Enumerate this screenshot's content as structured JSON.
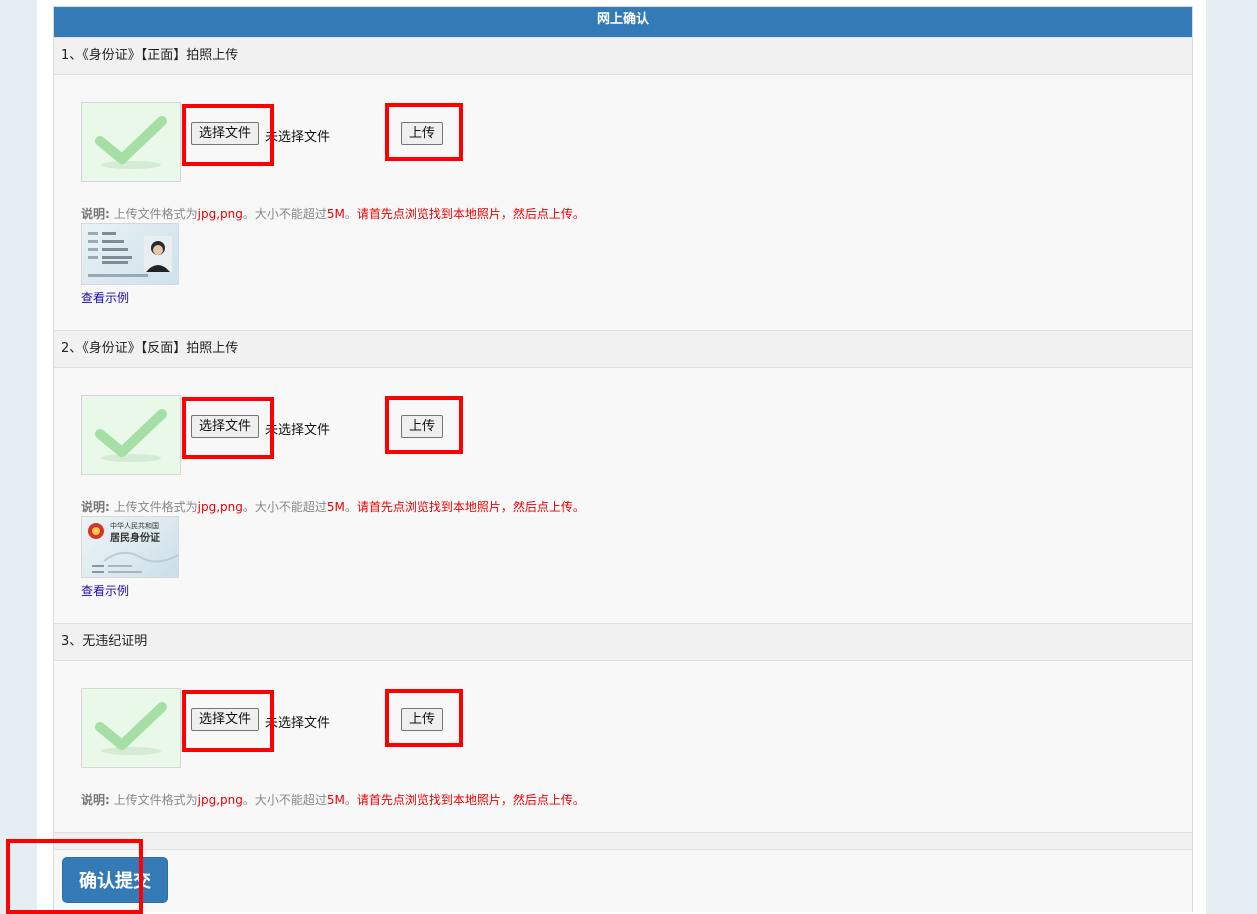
{
  "panel": {
    "title": "网上确认"
  },
  "sections": [
    {
      "title": "1、《身份证》【正面】拍照上传",
      "choose_label": "选择文件",
      "no_file_text": "未选择文件",
      "upload_label": "上传",
      "note_label": "说明:",
      "note_text_1": "上传文件格式为",
      "note_formats": "jpg,png",
      "note_text_2": "。大小不能超过",
      "note_size": "5M",
      "note_text_3": "。",
      "note_instruction": "请首先点浏览找到本地照片，然后点上传。",
      "view_example": "查看示例"
    },
    {
      "title": "2、《身份证》【反面】拍照上传",
      "choose_label": "选择文件",
      "no_file_text": "未选择文件",
      "upload_label": "上传",
      "note_label": "说明:",
      "note_text_1": "上传文件格式为",
      "note_formats": "jpg,png",
      "note_text_2": "。大小不能超过",
      "note_size": "5M",
      "note_text_3": "。",
      "note_instruction": "请首先点浏览找到本地照片，然后点上传。",
      "view_example": "查看示例",
      "back_card": {
        "country": "中华人民共和国",
        "title": "居民身份证"
      }
    },
    {
      "title": "3、无违纪证明",
      "choose_label": "选择文件",
      "no_file_text": "未选择文件",
      "upload_label": "上传",
      "note_label": "说明:",
      "note_text_1": "上传文件格式为",
      "note_formats": "jpg,png",
      "note_text_2": "。大小不能超过",
      "note_size": "5M",
      "note_text_3": "。",
      "note_instruction": "请首先点浏览找到本地照片，然后点上传。"
    }
  ],
  "submit": {
    "label": "确认提交"
  },
  "colors": {
    "header": "#337ab7",
    "highlight": "#ff0000",
    "warning_text": "#e00000",
    "link": "#1a0dab"
  },
  "icons": {
    "thumbnail": "checkmark-icon"
  }
}
